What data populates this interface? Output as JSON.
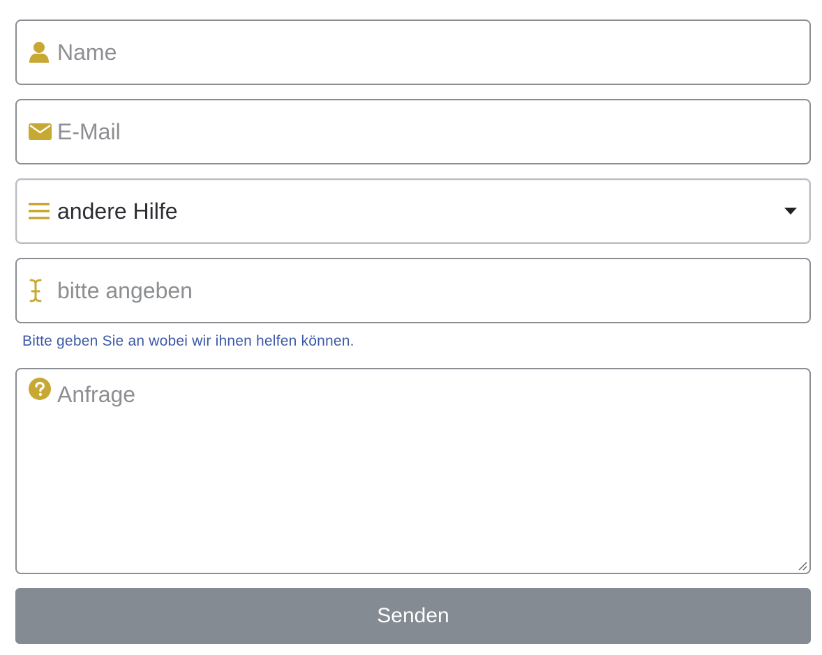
{
  "colors": {
    "icon_accent": "#c6a833",
    "border": "#8a8d91",
    "placeholder": "#8c8e91",
    "help_text": "#3c5aa6",
    "button_bg": "#858b92"
  },
  "form": {
    "name": {
      "icon": "user-icon",
      "placeholder": "Name"
    },
    "email": {
      "icon": "envelope-icon",
      "placeholder": "E-Mail"
    },
    "topic": {
      "icon": "bars-icon",
      "selected": "andere Hilfe"
    },
    "details": {
      "icon": "text-cursor-icon",
      "placeholder": "bitte angeben",
      "help": "Bitte geben Sie an wobei wir ihnen helfen können."
    },
    "request": {
      "icon": "question-circle-icon",
      "placeholder": "Anfrage"
    },
    "submit_label": "Senden"
  }
}
